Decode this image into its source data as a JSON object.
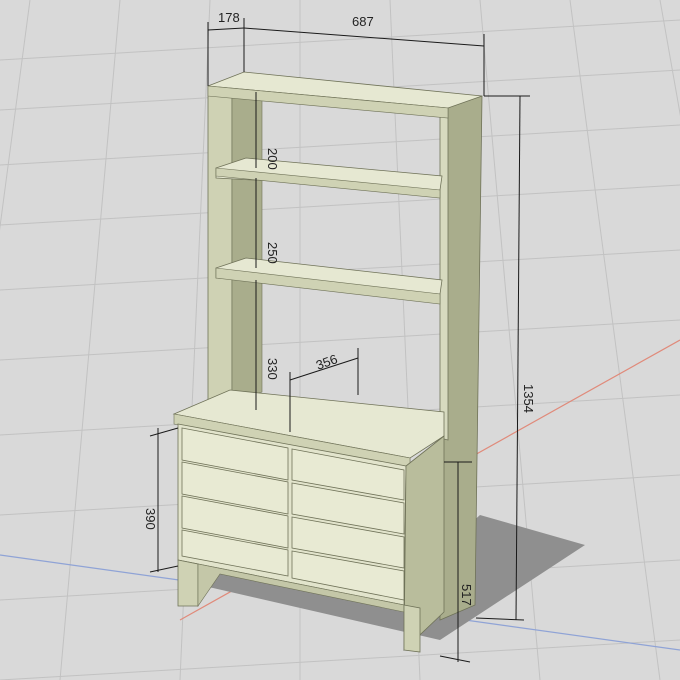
{
  "dimensions": {
    "depth": "178",
    "width": "687",
    "shelf_gap_top": "200",
    "shelf_gap_middle": "250",
    "shelf_gap_bottom": "330",
    "counter_depth": "356",
    "total_height": "1354",
    "drawer_height": "390",
    "base_height": "517"
  },
  "colors": {
    "background": "#d9d9d9",
    "grid": "#c2c2c2",
    "wood_light": "#e6e8d2",
    "wood_mid": "#cfd2b4",
    "wood_dark": "#a9ad8c",
    "shadow": "#8f8f8f",
    "axis_red": "#e08a7a",
    "axis_blue": "#8fa3d6"
  }
}
